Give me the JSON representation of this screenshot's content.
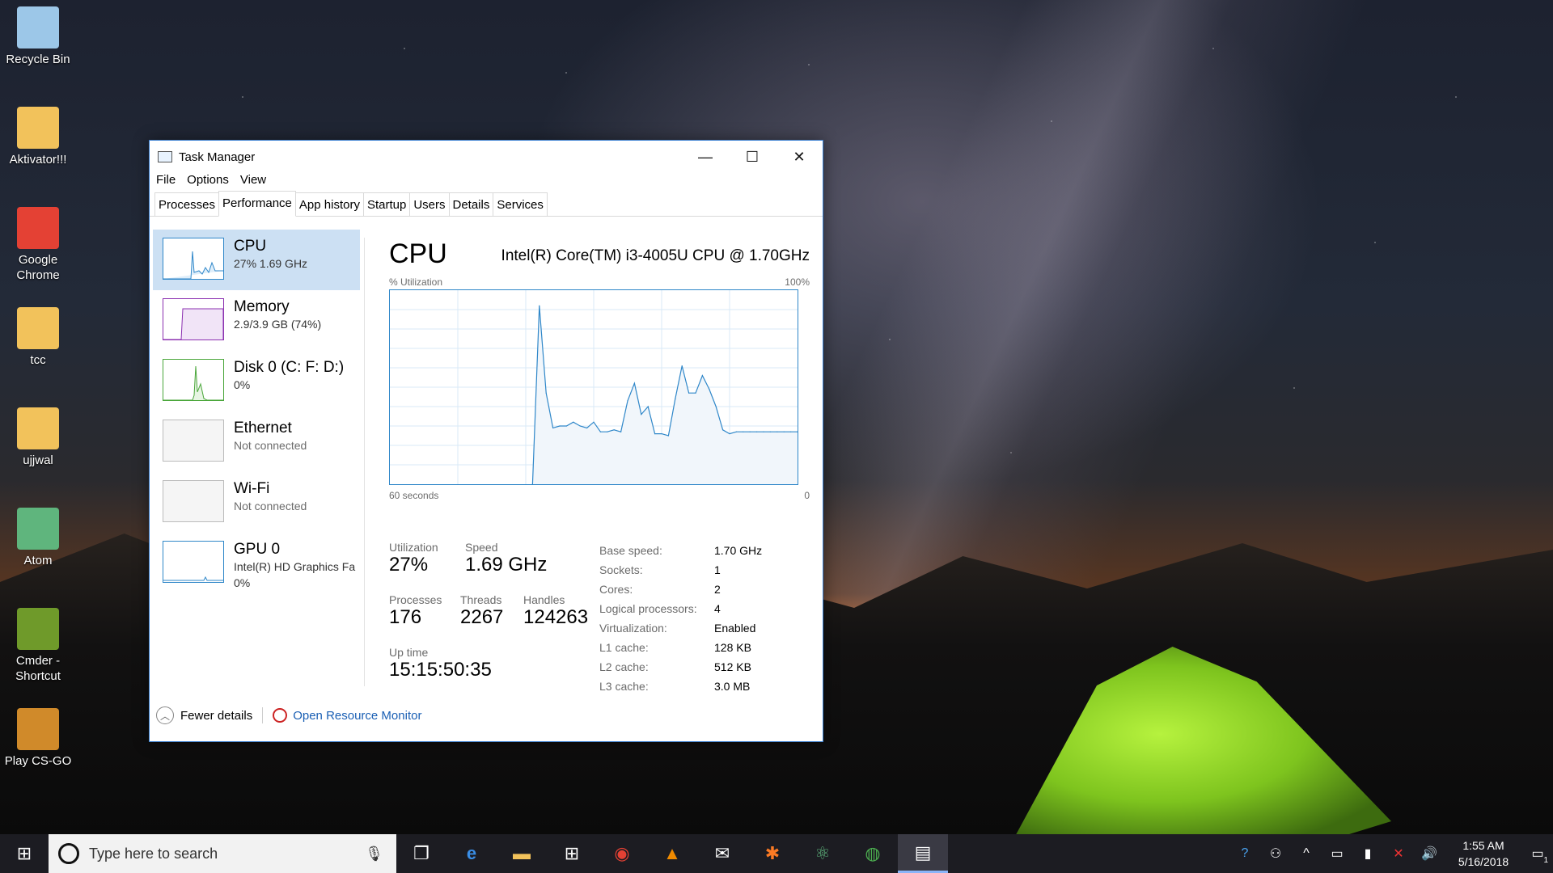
{
  "desktop": {
    "icons": [
      {
        "label": "Recycle Bin",
        "icon": "recycle-bin-icon",
        "color": "#9cc7e8"
      },
      {
        "label": "Aktivator!!!",
        "icon": "folder-icon",
        "color": "#f2c25b"
      },
      {
        "label": "Google Chrome",
        "icon": "chrome-icon",
        "color": "#e44134"
      },
      {
        "label": "tcc",
        "icon": "folder-icon",
        "color": "#f2c25b"
      },
      {
        "label": "ujjwal",
        "icon": "folder-icon",
        "color": "#f2c25b"
      },
      {
        "label": "Atom",
        "icon": "atom-icon",
        "color": "#5fb57d"
      },
      {
        "label": "Cmder - Shortcut",
        "icon": "cmder-icon",
        "color": "#6f9a2a"
      },
      {
        "label": "Play CS-GO",
        "icon": "csgo-icon",
        "color": "#d08a2a"
      }
    ]
  },
  "window": {
    "title": "Task Manager",
    "controls": {
      "minimize": "—",
      "maximize": "☐",
      "close": "✕"
    },
    "menu": [
      "File",
      "Options",
      "View"
    ],
    "tabs": [
      "Processes",
      "Performance",
      "App history",
      "Startup",
      "Users",
      "Details",
      "Services"
    ],
    "active_tab": "Performance",
    "sidebar": [
      {
        "title": "CPU",
        "sub": "27%  1.69 GHz",
        "color": "#2f87c9"
      },
      {
        "title": "Memory",
        "sub": "2.9/3.9 GB (74%)",
        "color": "#8b2fb0"
      },
      {
        "title": "Disk 0 (C: F: D:)",
        "sub": "0%",
        "color": "#4aa63a"
      },
      {
        "title": "Ethernet",
        "sub": "Not connected",
        "color": "#aaaaaa"
      },
      {
        "title": "Wi-Fi",
        "sub": "Not connected",
        "color": "#aaaaaa"
      },
      {
        "title": "GPU 0",
        "sub": "Intel(R) HD Graphics Fa",
        "sub2": "0%",
        "color": "#2f87c9"
      }
    ],
    "main": {
      "heading": "CPU",
      "processor": "Intel(R) Core(TM) i3-4005U CPU @ 1.70GHz",
      "axis_top_left": "% Utilization",
      "axis_top_right": "100%",
      "axis_bottom_left": "60 seconds",
      "axis_bottom_right": "0",
      "stats": {
        "utilization_label": "Utilization",
        "utilization": "27%",
        "speed_label": "Speed",
        "speed": "1.69 GHz",
        "processes_label": "Processes",
        "processes": "176",
        "threads_label": "Threads",
        "threads": "2267",
        "handles_label": "Handles",
        "handles": "124263",
        "uptime_label": "Up time",
        "uptime": "15:15:50:35"
      },
      "specs": [
        {
          "k": "Base speed:",
          "v": "1.70 GHz"
        },
        {
          "k": "Sockets:",
          "v": "1"
        },
        {
          "k": "Cores:",
          "v": "2"
        },
        {
          "k": "Logical processors:",
          "v": "4"
        },
        {
          "k": "Virtualization:",
          "v": "Enabled"
        },
        {
          "k": "L1 cache:",
          "v": "128 KB"
        },
        {
          "k": "L2 cache:",
          "v": "512 KB"
        },
        {
          "k": "L3 cache:",
          "v": "3.0 MB"
        }
      ]
    },
    "footer": {
      "fewer_details": "Fewer details",
      "resource_monitor": "Open Resource Monitor"
    }
  },
  "chart_data": {
    "type": "area",
    "x": [
      60,
      59,
      58,
      57,
      56,
      55,
      54,
      53,
      52,
      51,
      50,
      49,
      48,
      47,
      46,
      45,
      44,
      43,
      42,
      41,
      40,
      39,
      38,
      37,
      36,
      35,
      34,
      33,
      32,
      31,
      30,
      29,
      28,
      27,
      26,
      25,
      24,
      23,
      22,
      21,
      20,
      19,
      18,
      17,
      16,
      15,
      14,
      13,
      12,
      11,
      10,
      9,
      8,
      7,
      6,
      5,
      4,
      3,
      2,
      1,
      0
    ],
    "series": [
      {
        "values": [
          null,
          null,
          null,
          null,
          null,
          null,
          null,
          null,
          null,
          null,
          null,
          null,
          null,
          null,
          null,
          null,
          null,
          null,
          null,
          null,
          null,
          0,
          92,
          47,
          29,
          30,
          30,
          32,
          30,
          29,
          32,
          27,
          27,
          28,
          27,
          43,
          52,
          36,
          40,
          26,
          26,
          25,
          44,
          61,
          47,
          47,
          56,
          49,
          40,
          28,
          26,
          27,
          27,
          27,
          27,
          27,
          27,
          27,
          27,
          27,
          27
        ]
      }
    ],
    "ylim": [
      0,
      100
    ],
    "xlim": [
      60,
      0
    ],
    "grid": true,
    "color": "#2f87c9"
  },
  "taskbar": {
    "search_placeholder": "Type here to search",
    "apps": [
      "task-view-icon",
      "edge-icon",
      "file-explorer-icon",
      "store-icon",
      "chrome-icon",
      "vlc-icon",
      "mail-icon",
      "xampp-icon",
      "atom-icon",
      "chrome-remote-icon",
      "task-manager-icon"
    ],
    "time": "1:55 AM",
    "date": "5/16/2018",
    "notification_count": "1"
  }
}
